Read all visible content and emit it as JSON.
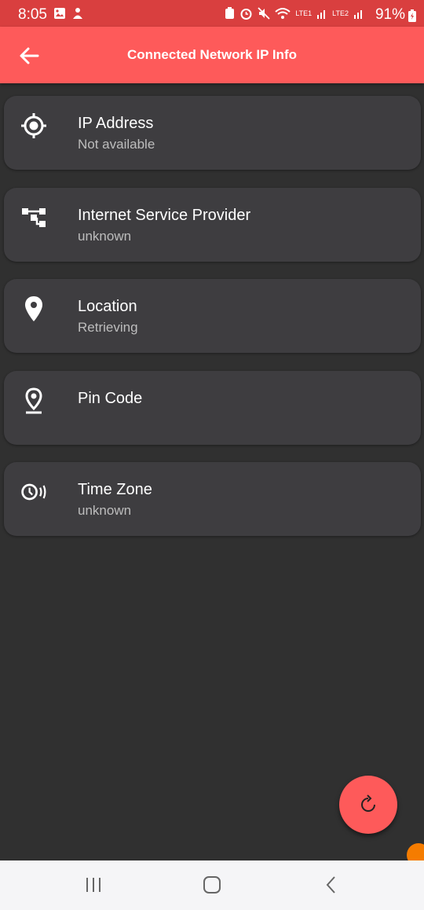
{
  "status_bar": {
    "time": "8:05",
    "battery_percent": "91%",
    "sim1_label": "LTE1",
    "sim2_label": "LTE2"
  },
  "app_bar": {
    "title": "Connected Network IP Info"
  },
  "cards": [
    {
      "icon": "crosshair-icon",
      "label": "IP Address",
      "value": "Not available"
    },
    {
      "icon": "network-tree-icon",
      "label": "Internet Service Provider",
      "value": "unknown"
    },
    {
      "icon": "location-pin-icon",
      "label": "Location",
      "value": "Retrieving"
    },
    {
      "icon": "pin-drop-icon",
      "label": "Pin Code",
      "value": ""
    },
    {
      "icon": "clock-signal-icon",
      "label": "Time Zone",
      "value": "unknown"
    }
  ],
  "colors": {
    "accent": "#fe5a5a",
    "status_bar": "#d93f3f",
    "background": "#303030",
    "card": "#3e3d40"
  }
}
